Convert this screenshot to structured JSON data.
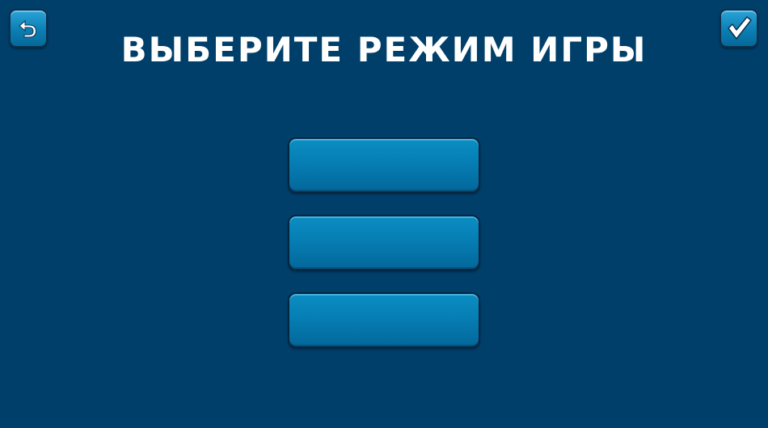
{
  "screen": {
    "title": "ВЫБЕРИТЕ РЕЖИМ ИГРЫ",
    "background_color": "#003f6a"
  },
  "toolbar": {
    "back_icon": "undo-arrow-icon",
    "confirm_icon": "checkmark-icon",
    "button_color": "#0b7fb5"
  },
  "modes": [
    {
      "label": ""
    },
    {
      "label": ""
    },
    {
      "label": ""
    }
  ]
}
